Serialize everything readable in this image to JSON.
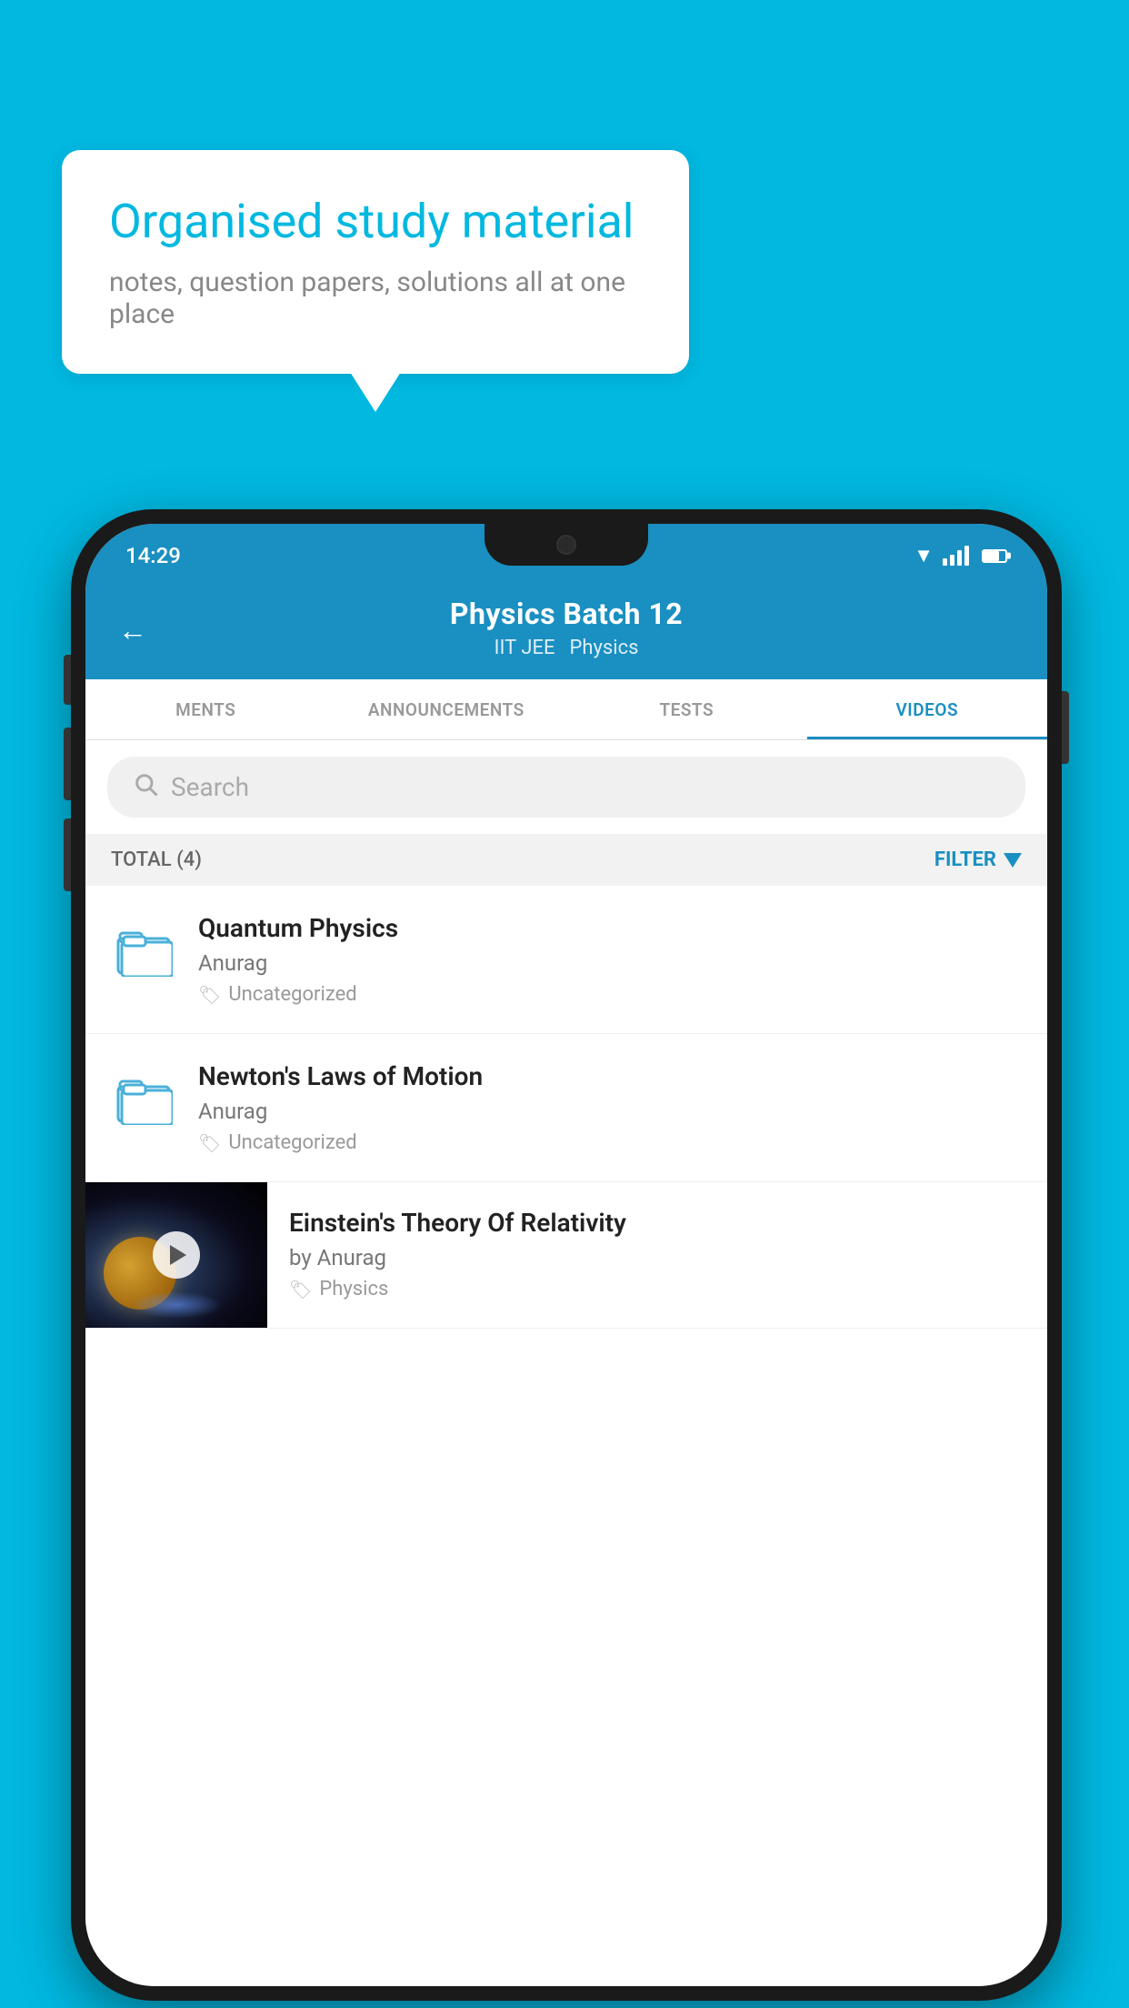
{
  "page": {
    "background_color": "#00B8E0"
  },
  "speech_bubble": {
    "title": "Organised study material",
    "subtitle": "notes, question papers, solutions all at one place"
  },
  "status_bar": {
    "time": "14:29"
  },
  "app_header": {
    "back_label": "←",
    "title": "Physics Batch 12",
    "tag1": "IIT JEE",
    "tag2": "Physics"
  },
  "tabs": [
    {
      "label": "MENTS",
      "active": false
    },
    {
      "label": "ANNOUNCEMENTS",
      "active": false
    },
    {
      "label": "TESTS",
      "active": false
    },
    {
      "label": "VIDEOS",
      "active": true
    }
  ],
  "search": {
    "placeholder": "Search"
  },
  "filter_bar": {
    "total_label": "TOTAL (4)",
    "filter_label": "FILTER"
  },
  "list_items": [
    {
      "title": "Quantum Physics",
      "author": "Anurag",
      "tag": "Uncategorized",
      "has_thumb": false
    },
    {
      "title": "Newton's Laws of Motion",
      "author": "Anurag",
      "tag": "Uncategorized",
      "has_thumb": false
    },
    {
      "title": "Einstein's Theory Of Relativity",
      "author": "by Anurag",
      "tag": "Physics",
      "has_thumb": true
    }
  ]
}
